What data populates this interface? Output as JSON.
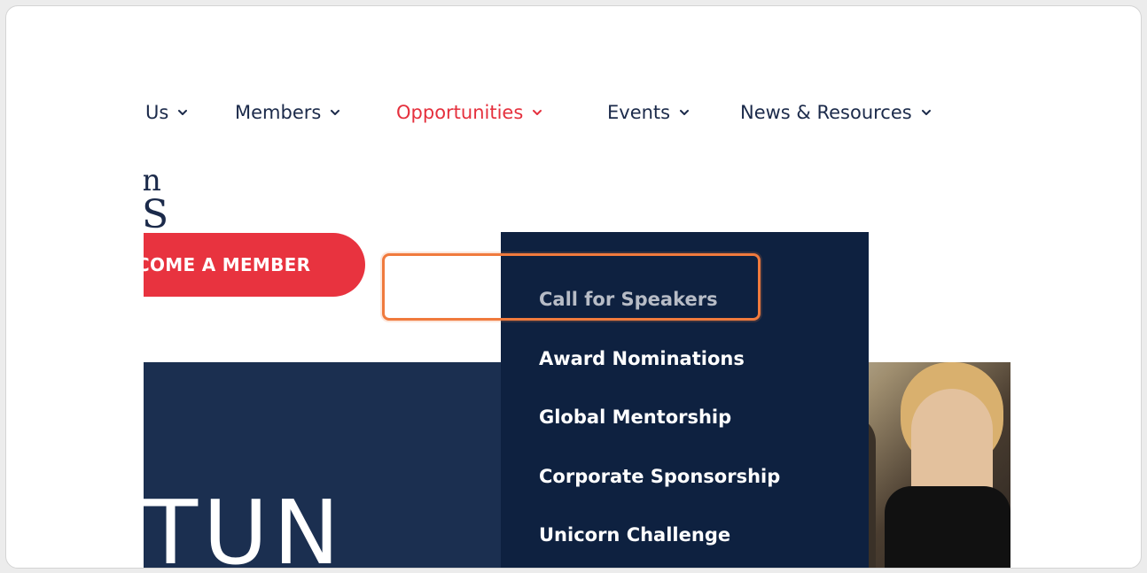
{
  "nav": {
    "items": [
      {
        "label": "Us",
        "active": false
      },
      {
        "label": "Members",
        "active": false
      },
      {
        "label": "Opportunities",
        "active": true
      },
      {
        "label": "Events",
        "active": false
      },
      {
        "label": "News & Resources",
        "active": false
      }
    ]
  },
  "logo": {
    "line1": "n",
    "line2": "S"
  },
  "cta": {
    "label": "COME A MEMBER"
  },
  "hero": {
    "text": "TUN"
  },
  "dropdown": {
    "items": [
      {
        "label": "Call for Speakers",
        "hovered": true
      },
      {
        "label": "Award Nominations",
        "hovered": false
      },
      {
        "label": "Global Mentorship",
        "hovered": false
      },
      {
        "label": "Corporate Sponsorship",
        "hovered": false
      },
      {
        "label": "Unicorn Challenge",
        "hovered": false
      }
    ]
  },
  "colors": {
    "navy": "#1b2a4a",
    "accent_red": "#e5303d",
    "dropdown_bg": "#0e2140",
    "highlight": "#f07a3d"
  },
  "icons": {
    "nav_chevron": "chevron-down-icon"
  }
}
